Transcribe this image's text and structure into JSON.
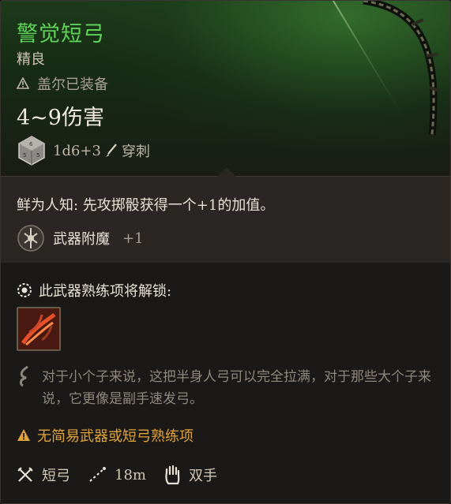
{
  "item": {
    "name": "警觉短弓",
    "rarity": "精良",
    "equipped_by": "盖尔已装备",
    "damage": "4~9伤害",
    "damage_dice": "1d6+3",
    "damage_type": "穿刺",
    "colors": {
      "name": "#5fd25a",
      "warning": "#e0a23a"
    }
  },
  "passive": {
    "description": "鲜为人知: 先攻掷骰获得一个+1的加值。",
    "enchant_label": "武器附魔",
    "enchant_bonus": "+1"
  },
  "proficiency": {
    "unlock_text": "此武器熟练项将解锁:",
    "skill_icon": "piercing-shot-icon"
  },
  "lore": "对于小个子来说，这把半身人弓可以完全拉满，对于那些大个子来说，它更像是副手速发弓。",
  "warning": "无简易武器或短弓熟练项",
  "properties": {
    "weapon_type": "短弓",
    "range": "18m",
    "handedness": "双手"
  }
}
